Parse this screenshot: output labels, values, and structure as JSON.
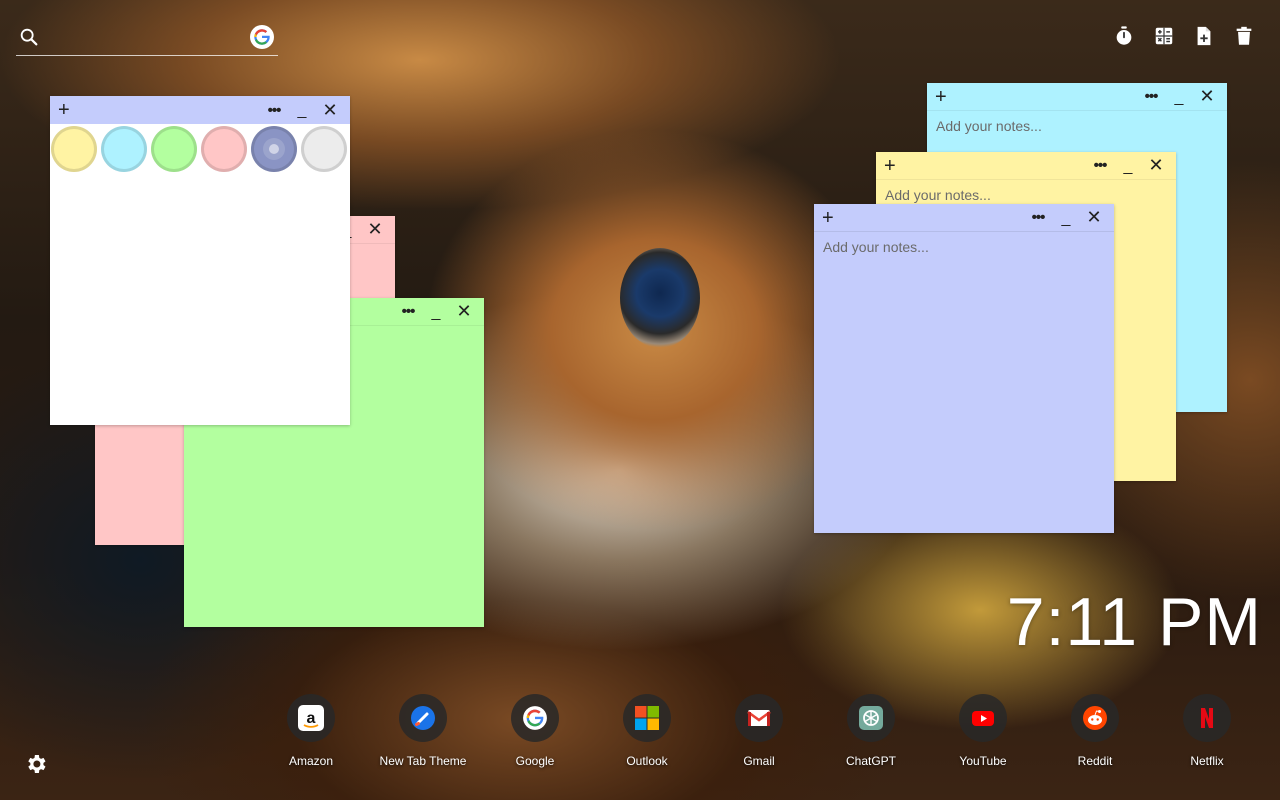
{
  "search": {
    "icon": "search-icon",
    "engine_icon": "google-icon"
  },
  "toolbar": [
    {
      "icon": "timer-icon"
    },
    {
      "icon": "calculator-icon"
    },
    {
      "icon": "add-note-icon"
    },
    {
      "icon": "trash-icon"
    }
  ],
  "notes": {
    "placeholder": "Add your notes...",
    "add_symbol": "+",
    "menu_symbol": "•••",
    "minimize_symbol": "_",
    "close_symbol": "✕"
  },
  "color_picker": {
    "swatches": [
      "#fff3a3",
      "#aef2ff",
      "#b3ff9f",
      "#ffc6c6",
      "#8a94c4",
      "#ececec"
    ],
    "selected": "#8a94c4"
  },
  "clock": {
    "time": "7:11 PM"
  },
  "dock": [
    {
      "label": "Amazon",
      "icon": "amazon-icon"
    },
    {
      "label": "New Tab Theme",
      "icon": "new-tab-theme-icon"
    },
    {
      "label": "Google",
      "icon": "google-icon"
    },
    {
      "label": "Outlook",
      "icon": "outlook-icon"
    },
    {
      "label": "Gmail",
      "icon": "gmail-icon"
    },
    {
      "label": "ChatGPT",
      "icon": "chatgpt-icon"
    },
    {
      "label": "YouTube",
      "icon": "youtube-icon"
    },
    {
      "label": "Reddit",
      "icon": "reddit-icon"
    },
    {
      "label": "Netflix",
      "icon": "netflix-icon"
    }
  ],
  "settings": {
    "icon": "gear-icon"
  }
}
